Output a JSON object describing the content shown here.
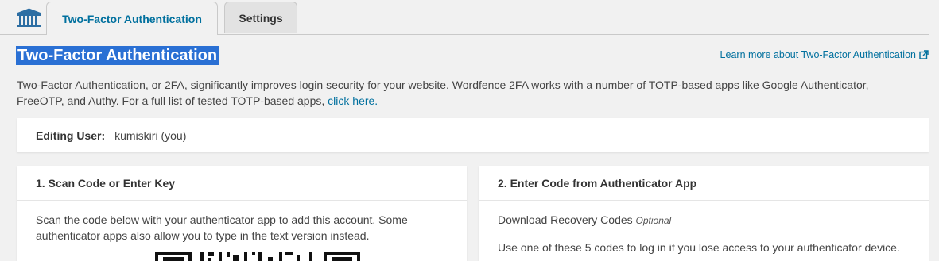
{
  "tabs": [
    {
      "label": "Two-Factor Authentication",
      "active": true
    },
    {
      "label": "Settings",
      "active": false
    }
  ],
  "header": {
    "title": "Two-Factor Authentication",
    "learn_more": "Learn more about Two-Factor Authentication",
    "intro_text": "Two-Factor Authentication, or 2FA, significantly improves login security for your website. Wordfence 2FA works with a number of TOTP-based apps like Google Authenticator, FreeOTP, and Authy. For a full list of tested TOTP-based apps,",
    "intro_link": "click here."
  },
  "editing_user": {
    "label": "Editing User:",
    "value": "kumiskiri (you)"
  },
  "scan_card": {
    "title": "1. Scan Code or Enter Key",
    "description": "Scan the code below with your authenticator app to add this account. Some authenticator apps also allow you to type in the text version instead."
  },
  "code_card": {
    "title": "2. Enter Code from Authenticator App",
    "recovery_label": "Download Recovery Codes",
    "recovery_optional": "Optional",
    "recovery_info": "Use one of these 5 codes to log in if you lose access to your authenticator device."
  },
  "icons": {
    "logo": "wordfence-logo-icon",
    "external": "external-link-icon"
  },
  "colors": {
    "link": "#00709e",
    "page_bg": "#f1f1f1",
    "selection": "#2a70d4"
  }
}
